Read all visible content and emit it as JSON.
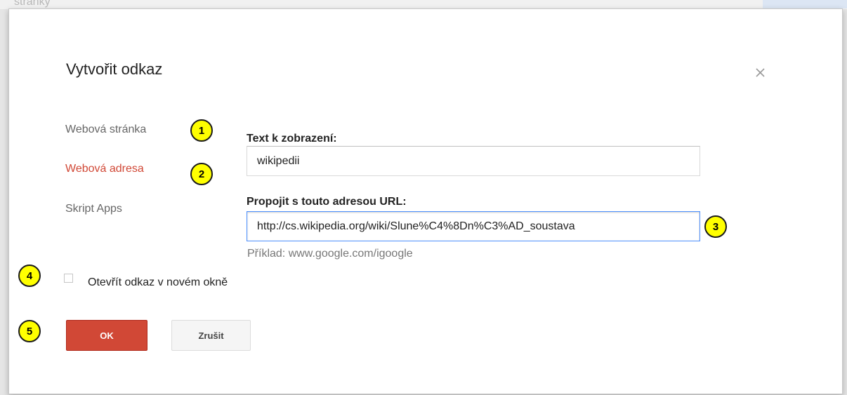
{
  "background": {
    "top_text": "stranky"
  },
  "dialog": {
    "title": "Vytvořit odkaz",
    "close_icon": "close-icon"
  },
  "sidebar": {
    "items": [
      {
        "label": "Webová stránka",
        "active": false
      },
      {
        "label": "Webová adresa",
        "active": true
      },
      {
        "label": "Skript Apps",
        "active": false
      }
    ]
  },
  "form": {
    "display_text_label": "Text k zobrazení:",
    "display_text_value": "wikipedii",
    "url_label": "Propojit s touto adresou URL:",
    "url_value": "http://cs.wikipedia.org/wiki/Slune%C4%8Dn%C3%AD_soustava",
    "example_hint": "Příklad: www.google.com/igoogle",
    "new_window_label": "Otevřít odkaz v novém okně",
    "new_window_checked": false
  },
  "buttons": {
    "ok_label": "OK",
    "cancel_label": "Zrušit"
  },
  "callouts": [
    "1",
    "2",
    "3",
    "4",
    "5"
  ],
  "colors": {
    "accent_red": "#d14836",
    "callout_yellow": "#ffff00",
    "focus_blue": "#4d90fe"
  }
}
